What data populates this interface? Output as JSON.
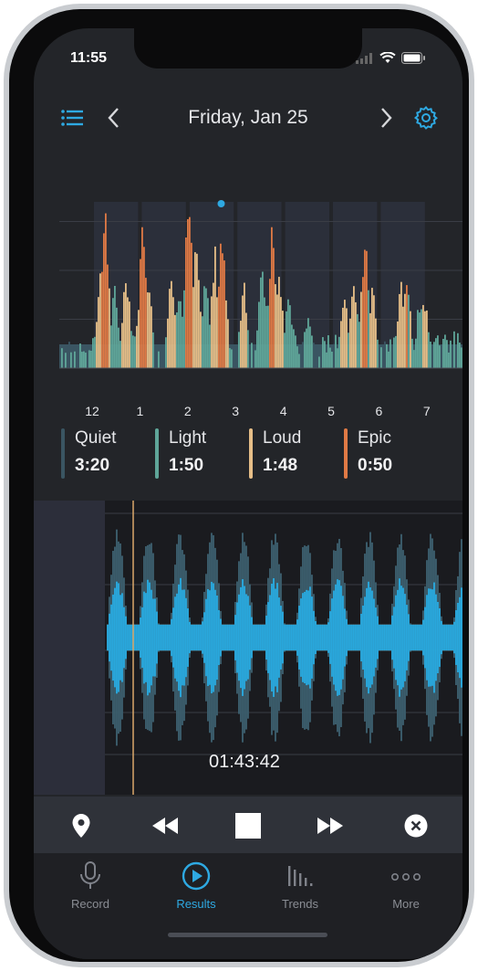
{
  "status": {
    "time": "11:55"
  },
  "header": {
    "title": "Friday, Jan 25"
  },
  "chart_data": {
    "type": "bar",
    "xlabel": "",
    "ylabel": "",
    "x_ticks": [
      "12",
      "1",
      "2",
      "3",
      "4",
      "5",
      "6",
      "7"
    ],
    "series": [
      {
        "name": "Quiet",
        "color": "#3a5562"
      },
      {
        "name": "Light",
        "color": "#5fa699"
      },
      {
        "name": "Loud",
        "color": "#e6be87"
      },
      {
        "name": "Epic",
        "color": "#e07a45"
      }
    ],
    "grid": true,
    "peaks": [
      {
        "x": 0.15,
        "level": "Loud",
        "value": 0.55
      },
      {
        "x": 0.25,
        "level": "Epic",
        "value": 0.92
      },
      {
        "x": 0.45,
        "level": "Light",
        "value": 0.45
      },
      {
        "x": 0.7,
        "level": "Loud",
        "value": 0.6
      },
      {
        "x": 1.05,
        "level": "Epic",
        "value": 0.9
      },
      {
        "x": 1.15,
        "level": "Loud",
        "value": 0.55
      },
      {
        "x": 1.65,
        "level": "Loud",
        "value": 0.6
      },
      {
        "x": 1.8,
        "level": "Light",
        "value": 0.5
      },
      {
        "x": 2.0,
        "level": "Epic",
        "value": 0.98
      },
      {
        "x": 2.15,
        "level": "Loud",
        "value": 0.7
      },
      {
        "x": 2.35,
        "level": "Light",
        "value": 0.55
      },
      {
        "x": 2.7,
        "level": "Epic",
        "value": 0.88
      },
      {
        "x": 2.55,
        "level": "Loud",
        "value": 0.65
      },
      {
        "x": 3.15,
        "level": "Loud",
        "value": 0.5
      },
      {
        "x": 3.55,
        "level": "Light",
        "value": 0.6
      },
      {
        "x": 3.75,
        "level": "Epic",
        "value": 0.78
      },
      {
        "x": 3.9,
        "level": "Loud",
        "value": 0.55
      },
      {
        "x": 4.1,
        "level": "Light",
        "value": 0.45
      },
      {
        "x": 4.5,
        "level": "Light",
        "value": 0.35
      },
      {
        "x": 5.25,
        "level": "Loud",
        "value": 0.45
      },
      {
        "x": 5.45,
        "level": "Loud",
        "value": 0.55
      },
      {
        "x": 5.7,
        "level": "Epic",
        "value": 0.84
      },
      {
        "x": 5.85,
        "level": "Loud",
        "value": 0.48
      },
      {
        "x": 6.45,
        "level": "Loud",
        "value": 0.55
      },
      {
        "x": 6.55,
        "level": "Epic",
        "value": 0.6
      },
      {
        "x": 6.85,
        "level": "Light",
        "value": 0.45
      },
      {
        "x": 6.95,
        "level": "Loud",
        "value": 0.42
      }
    ],
    "marker_x": 2.7
  },
  "legend": [
    {
      "label": "Quiet",
      "value": "3:20",
      "color": "#3a5562"
    },
    {
      "label": "Light",
      "value": "1:50",
      "color": "#5fa699"
    },
    {
      "label": "Loud",
      "value": "1:48",
      "color": "#e6be87"
    },
    {
      "label": "Epic",
      "value": "0:50",
      "color": "#e07a45"
    }
  ],
  "playback": {
    "timecode": "01:43:42"
  },
  "tabs": [
    {
      "label": "Record",
      "icon": "microphone-icon",
      "active": false
    },
    {
      "label": "Results",
      "icon": "play-circle-icon",
      "active": true
    },
    {
      "label": "Trends",
      "icon": "bar-chart-icon",
      "active": false
    },
    {
      "label": "More",
      "icon": "dots-icon",
      "active": false
    }
  ],
  "colors": {
    "accent": "#2ea9e2",
    "background": "#232529",
    "waveform": "#29a8dd",
    "playhead": "#d9a86a"
  }
}
